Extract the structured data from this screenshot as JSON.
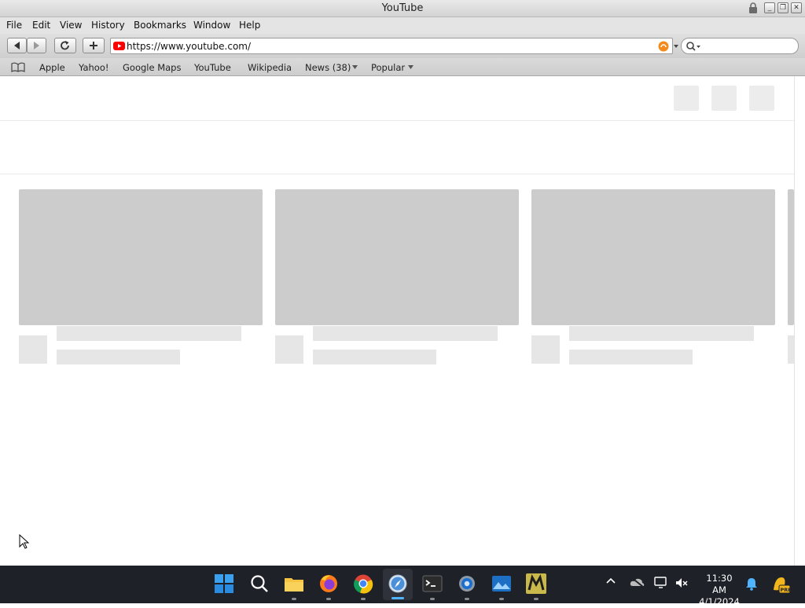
{
  "window": {
    "title": "YouTube"
  },
  "menu": {
    "items": [
      "File",
      "Edit",
      "View",
      "History",
      "Bookmarks",
      "Window",
      "Help"
    ]
  },
  "toolbar": {
    "back": "back-arrow",
    "forward": "forward-arrow",
    "reload": "reload-icon",
    "add": "plus-icon",
    "url": "https://www.youtube.com/",
    "search_placeholder": ""
  },
  "bookmarks": {
    "items": [
      "Apple",
      "Yahoo!",
      "Google Maps",
      "YouTube",
      "Wikipedia",
      "News (38)",
      "Popular"
    ]
  },
  "taskbar": {
    "time": "11:30 AM",
    "date": "4/1/2024",
    "apps": [
      "start",
      "search",
      "file-explorer",
      "firefox",
      "chrome",
      "safari",
      "terminal",
      "settings",
      "photos",
      "maxthon"
    ]
  },
  "colors": {
    "placeholder": "#cccccc",
    "skeleton": "#e6e6e6",
    "taskbar": "#1f2128",
    "youtube_red": "#ff0000"
  }
}
